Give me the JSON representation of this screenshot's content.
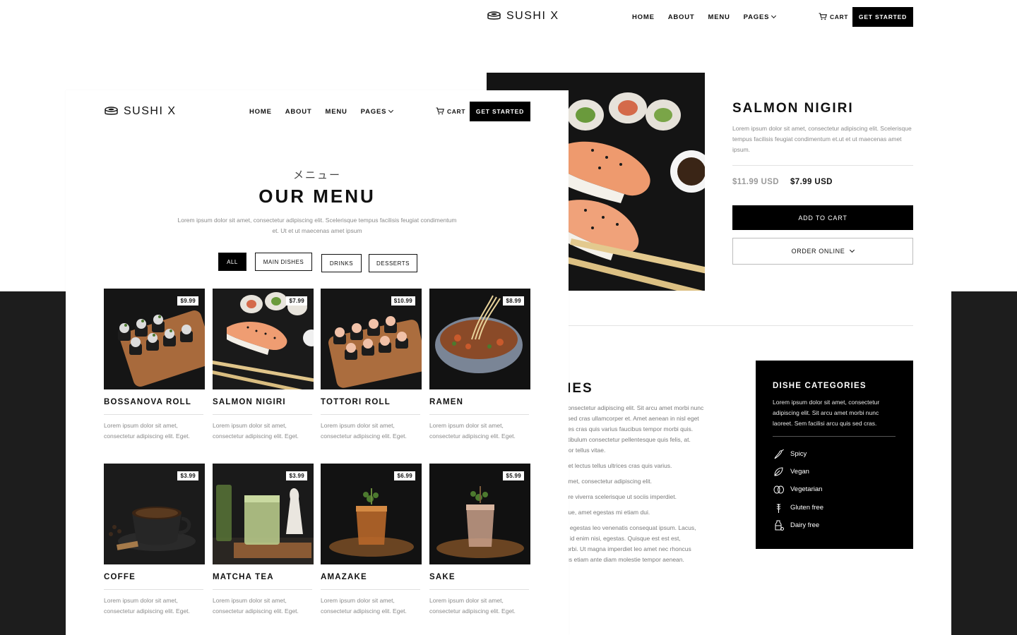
{
  "brand": {
    "name": "SUSHI X"
  },
  "nav": {
    "home": "HOME",
    "about": "ABOUT",
    "menu": "MENU",
    "pages": "PAGES",
    "cart": "CART",
    "cta": "GET STARTED"
  },
  "product": {
    "title": "SALMON NIGIRI",
    "description": "Lorem ipsum dolor sit amet, consectetur adipiscing elit. Scelerisque tempus facilisis feugiat condimentum et.ut et ut maecenas amet ipsum.",
    "old_price": "$11.99 USD",
    "price": "$7.99 USD",
    "add_to_cart": "ADD TO CART",
    "order_online": "ORDER ONLINE"
  },
  "dishes_section": {
    "heading": "E DISHES",
    "lines": [
      ", consectetur adipiscing elit. Sit arcu amet morbi nunc",
      "is sed cras ullamcorper et. Amet aenean in nisl eget",
      "rices cras quis varius faucibus tempor morbi quis.",
      "estibulum consectetur pellentesque quis felis, at.",
      "ortor tellus vitae.",
      "",
      "eget lectus tellus ultrices cras quis varius.",
      "",
      "t amet, consectetur adipiscing elit.",
      "",
      "uere viverra scelerisque ut sociis imperdiet.",
      "",
      "eque, amet egestas mi etiam dui.",
      "",
      "ed egestas leo venenatis consequat ipsum. Lacus,",
      "eu id enim nisi, egestas. Quisque est est est,",
      "morbi. Ut magna imperdiet leo amet nec rhoncus",
      "isus etiam ante diam molestie tempor aenean."
    ]
  },
  "categories": {
    "title": "DISHE CATEGORIES",
    "description": "Lorem ipsum dolor sit amet, consectetur adipiscing elit. Sit arcu amet morbi nunc laoreet. Sem facilisi arcu quis sed cras.",
    "items": [
      {
        "label": "Spicy",
        "icon": "chili-icon"
      },
      {
        "label": "Vegan",
        "icon": "leaf-icon"
      },
      {
        "label": "Vegetarian",
        "icon": "eggs-icon"
      },
      {
        "label": "Gluten free",
        "icon": "wheat-icon"
      },
      {
        "label": "Dairy free",
        "icon": "milk-icon"
      }
    ]
  },
  "menu": {
    "subtitle": "メニュー",
    "title": "OUR MENU",
    "description": "Lorem ipsum dolor sit amet, consectetur adipiscing elit. Scelerisque tempus facilisis feugiat condimentum et. Ut et ut maecenas amet ipsum",
    "filters": [
      "ALL",
      "MAIN DISHES",
      "DRINKS",
      "DESSERTS"
    ],
    "items": [
      {
        "name": "BOSSANOVA ROLL",
        "price": "$9.99",
        "description": "Lorem ipsum dolor sit amet, consectetur adipiscing elit. Eget."
      },
      {
        "name": "SALMON NIGIRI",
        "price": "$7.99",
        "description": "Lorem ipsum dolor sit amet, consectetur adipiscing elit. Eget."
      },
      {
        "name": "TOTTORI ROLL",
        "price": "$10.99",
        "description": "Lorem ipsum dolor sit amet, consectetur adipiscing elit. Eget."
      },
      {
        "name": "RAMEN",
        "price": "$8.99",
        "description": "Lorem ipsum dolor sit amet, consectetur adipiscing elit. Eget."
      },
      {
        "name": "COFFE",
        "price": "$3.99",
        "description": "Lorem ipsum dolor sit amet, consectetur adipiscing elit. Eget."
      },
      {
        "name": "MATCHA TEA",
        "price": "$3.99",
        "description": "Lorem ipsum dolor sit amet, consectetur adipiscing elit. Eget."
      },
      {
        "name": "AMAZAKE",
        "price": "$6.99",
        "description": "Lorem ipsum dolor sit amet, consectetur adipiscing elit. Eget."
      },
      {
        "name": "SAKE",
        "price": "$5.99",
        "description": "Lorem ipsum dolor sit amet, consectetur adipiscing elit. Eget."
      }
    ]
  },
  "colors": {
    "primary": "#000000",
    "background_dark": "#1d1d1d",
    "muted_text": "#8a8a8a",
    "old_price": "#9a9a9a"
  }
}
